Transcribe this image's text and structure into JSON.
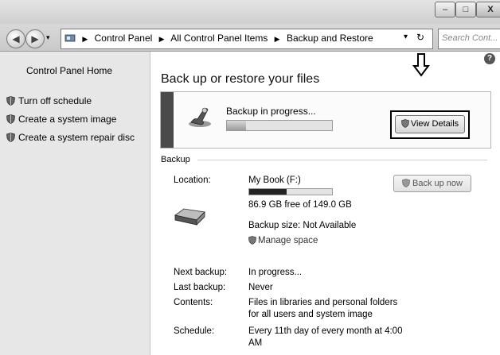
{
  "window": {
    "controls": {
      "minimize": "‒",
      "maximize": "□",
      "close": "X"
    }
  },
  "address": {
    "crumbs": [
      "Control Panel",
      "All Control Panel Items",
      "Backup and Restore"
    ],
    "search_placeholder": "Search Cont..."
  },
  "sidebar": {
    "home": "Control Panel Home",
    "items": [
      {
        "label": "Turn off schedule",
        "icon": "shield-icon"
      },
      {
        "label": "Create a system image",
        "icon": "shield-icon"
      },
      {
        "label": "Create a system repair disc",
        "icon": "shield-icon"
      }
    ]
  },
  "main": {
    "title": "Back up or restore your files",
    "help": "?",
    "progress": {
      "text": "Backup in progress...",
      "fraction": 0.18,
      "view_details": "View Details"
    },
    "section": "Backup",
    "location_label": "Location:",
    "location_value": "My Book (F:)",
    "drive_used_fraction": 0.45,
    "free_space": "86.9 GB free of 149.0 GB",
    "backup_size": "Backup size: Not Available",
    "manage_space": "Manage space",
    "back_up_now": "Back up now",
    "rows": [
      {
        "label": "Next backup:",
        "value": "In progress..."
      },
      {
        "label": "Last backup:",
        "value": "Never"
      },
      {
        "label": "Contents:",
        "value_line1": "Files in libraries and personal folders",
        "value_line2": "for all users and system image"
      },
      {
        "label": "Schedule:",
        "value_line1": "Every 11th day of every month at 4:00",
        "value_line2": "AM"
      }
    ]
  }
}
